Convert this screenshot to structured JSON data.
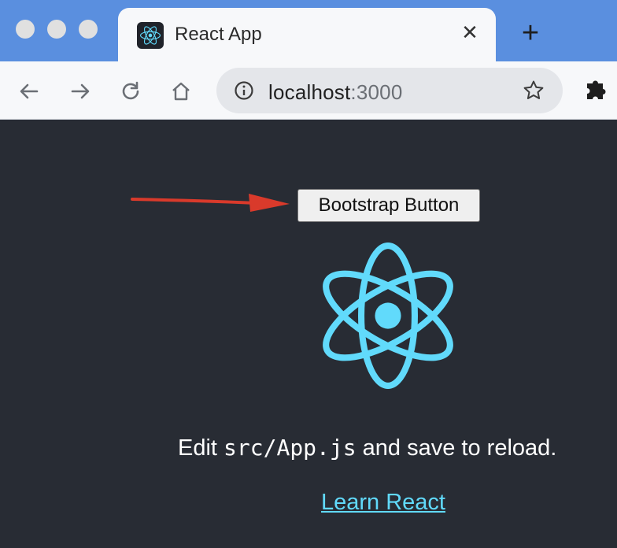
{
  "browser": {
    "tab": {
      "title": "React App",
      "favicon": "react-logo-icon",
      "close_glyph": "✕"
    },
    "new_tab_glyph": "+",
    "toolbar": {
      "icons": [
        "back-arrow-icon",
        "forward-arrow-icon",
        "reload-icon",
        "home-icon"
      ],
      "url_host": "localhost",
      "url_port": ":3000",
      "site_info_icon": "info-icon",
      "bookmark_icon": "star-icon",
      "extensions_icon": "puzzle-piece-icon"
    },
    "colors": {
      "tabstrip": "#5a8fdf",
      "toolbar": "#f7f8fa",
      "omnibox": "#e4e6ea"
    }
  },
  "page": {
    "button_label": "Bootstrap Button",
    "annotation": "red-arrow-pointing-to-button",
    "logo": "react-logo",
    "edit_prefix": "Edit ",
    "edit_code": "src/App.js",
    "edit_suffix": " and save to reload.",
    "link_label": "Learn React",
    "colors": {
      "background": "#282c34",
      "accent": "#61dafb",
      "arrow": "#d93a2b"
    }
  }
}
